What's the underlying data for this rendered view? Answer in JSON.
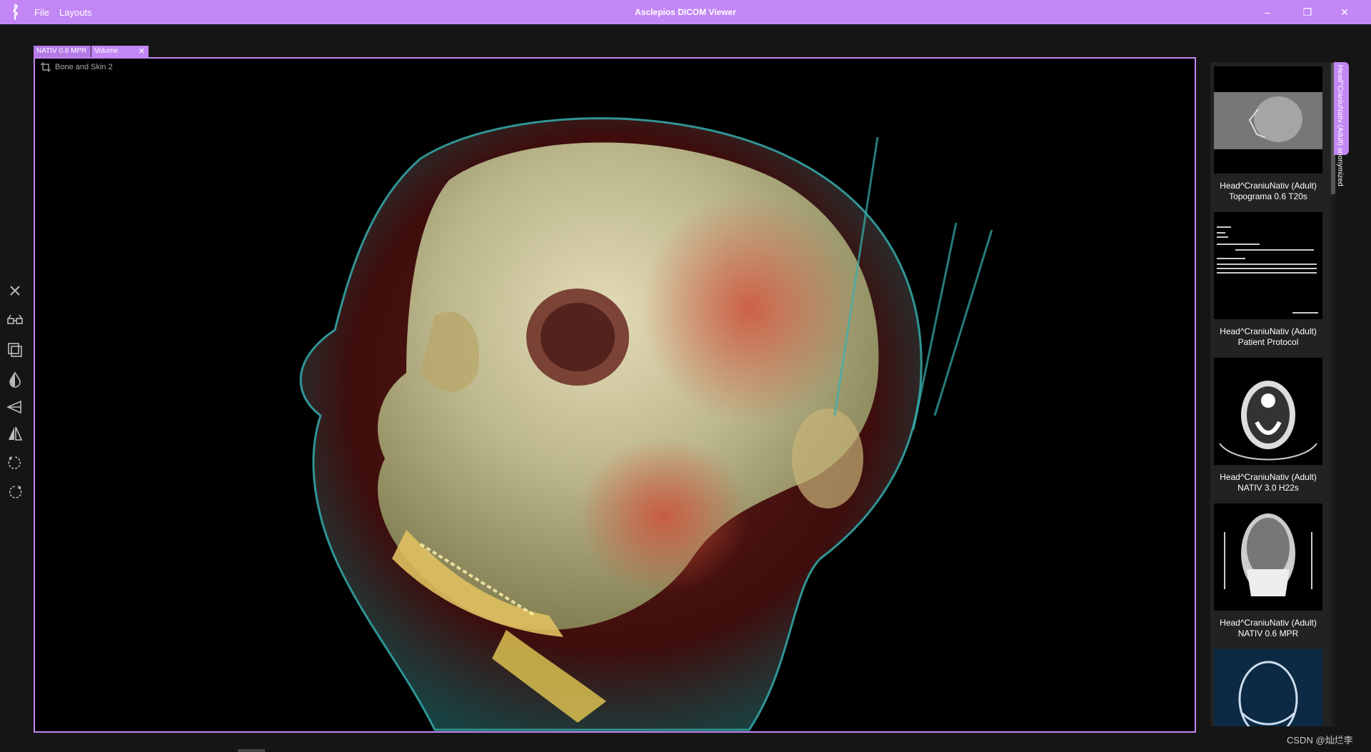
{
  "app": {
    "title": "Asclepios DICOM Viewer",
    "menu": [
      "File",
      "Layouts"
    ],
    "window_controls": {
      "minimize": "–",
      "maximize": "❐",
      "close": "✕"
    },
    "accent": "#c387f5"
  },
  "tabs": [
    {
      "label": "NATIV  0.6  MPR"
    },
    {
      "label": "Volume",
      "close": "✕"
    }
  ],
  "viewport": {
    "preset_label": "Bone and Skin 2"
  },
  "toolbar": [
    "close-icon",
    "glasses-icon",
    "layers-icon",
    "contrast-drop-icon",
    "flip-horizontal-icon",
    "mirror-icon",
    "rotate-left-icon",
    "rotate-right-icon"
  ],
  "series": [
    {
      "line1": "Head^CraniuNativ (Adult)",
      "line2": "Topograma  0.6  T20s"
    },
    {
      "line1": "Head^CraniuNativ (Adult)",
      "line2": "Patient Protocol"
    },
    {
      "line1": "Head^CraniuNativ (Adult)",
      "line2": "NATIV  3.0  H22s"
    },
    {
      "line1": "Head^CraniuNativ (Adult)",
      "line2": "NATIV  0.6  MPR"
    }
  ],
  "patient_tab": "Head^CraniuNativ (Adult) anonymized",
  "watermark": "CSDN @灿烂李"
}
